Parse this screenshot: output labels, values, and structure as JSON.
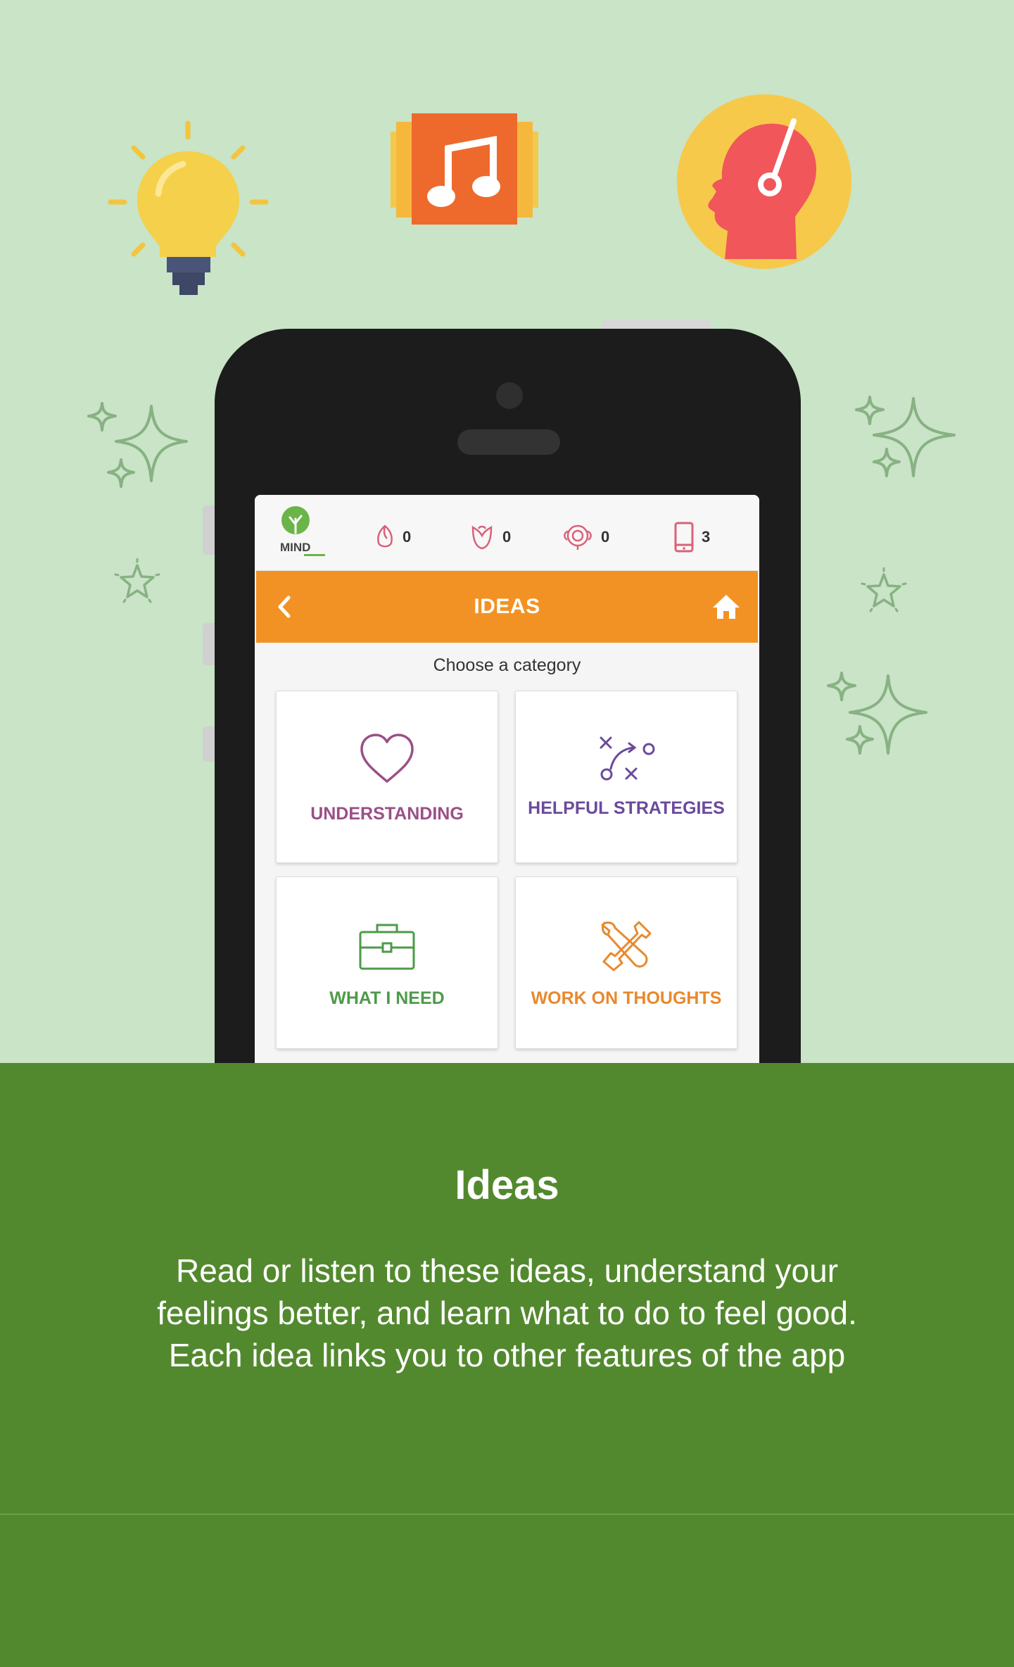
{
  "app": {
    "logo_text": "MIND",
    "screen_title": "IDEAS",
    "subtitle": "Choose a category"
  },
  "status_counters": [
    {
      "icon": "rosebud-icon",
      "value": "0"
    },
    {
      "icon": "tulip-icon",
      "value": "0"
    },
    {
      "icon": "rose-icon",
      "value": "0"
    },
    {
      "icon": "phone-icon",
      "value": "3"
    }
  ],
  "categories": [
    {
      "label": "UNDERSTANDING",
      "icon": "heart-icon",
      "color": "#9b4f86"
    },
    {
      "label": "HELPFUL STRATEGIES",
      "icon": "strategy-icon",
      "color": "#6a4a9c"
    },
    {
      "label": "WHAT I NEED",
      "icon": "briefcase-icon",
      "color": "#4e9a4a"
    },
    {
      "label": "WORK ON THOUGHTS",
      "icon": "tools-icon",
      "color": "#e8892e"
    }
  ],
  "caption": {
    "title": "Ideas",
    "body_line1": "Read or listen to these ideas, understand your",
    "body_line2": "feelings better, and learn what to do to feel good.",
    "body_line3": "Each idea links you to other features of the app"
  },
  "colors": {
    "background_light": "#c9e4c6",
    "background_dark": "#53892e",
    "accent_orange": "#f39224"
  }
}
